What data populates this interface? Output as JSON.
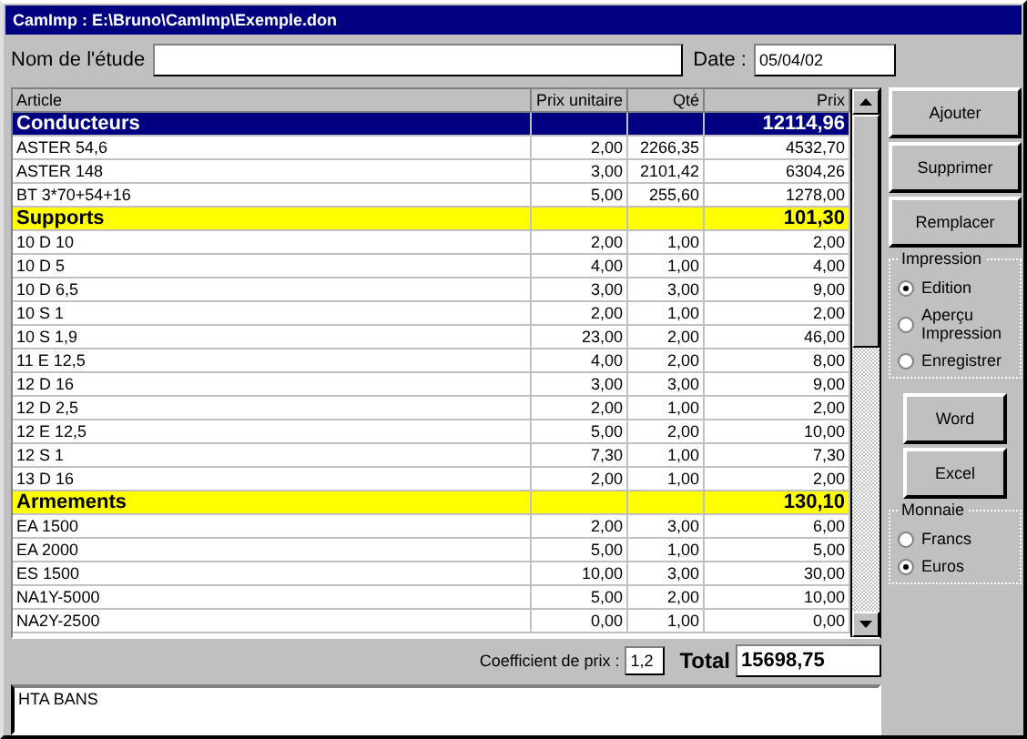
{
  "window": {
    "title": "CamImp : E:\\Bruno\\CamImp\\Exemple.don"
  },
  "study": {
    "label": "Nom de l'étude"
  },
  "date": {
    "label": "Date :",
    "value": "05/04/02"
  },
  "table": {
    "columns": [
      "Article",
      "Prix unitaire",
      "Qté",
      "Prix"
    ],
    "rows": [
      {
        "kind": "category",
        "name": "Conducteurs",
        "total": "12114,96",
        "color": "#000080"
      },
      {
        "kind": "item",
        "cells": [
          "ASTER  54,6",
          "2,00",
          "2266,35",
          "4532,70"
        ]
      },
      {
        "kind": "item",
        "cells": [
          "ASTER  148",
          "3,00",
          "2101,42",
          "6304,26"
        ]
      },
      {
        "kind": "item",
        "cells": [
          "BT  3*70+54+16",
          "5,00",
          "255,60",
          "1278,00"
        ]
      },
      {
        "kind": "category",
        "name": "Supports",
        "total": "101,30",
        "color": "#ffff00"
      },
      {
        "kind": "item",
        "cells": [
          "10 D 10",
          "2,00",
          "1,00",
          "2,00"
        ]
      },
      {
        "kind": "item",
        "cells": [
          "10 D 5",
          "4,00",
          "1,00",
          "4,00"
        ]
      },
      {
        "kind": "item",
        "cells": [
          "10 D 6,5",
          "3,00",
          "3,00",
          "9,00"
        ]
      },
      {
        "kind": "item",
        "cells": [
          "10 S 1",
          "2,00",
          "1,00",
          "2,00"
        ]
      },
      {
        "kind": "item",
        "cells": [
          "10 S 1,9",
          "23,00",
          "2,00",
          "46,00"
        ]
      },
      {
        "kind": "item",
        "cells": [
          "11 E 12,5",
          "4,00",
          "2,00",
          "8,00"
        ]
      },
      {
        "kind": "item",
        "cells": [
          "12 D 16",
          "3,00",
          "3,00",
          "9,00"
        ]
      },
      {
        "kind": "item",
        "cells": [
          "12 D 2,5",
          "2,00",
          "1,00",
          "2,00"
        ]
      },
      {
        "kind": "item",
        "cells": [
          "12 E 12,5",
          "5,00",
          "2,00",
          "10,00"
        ]
      },
      {
        "kind": "item",
        "cells": [
          "12 S 1",
          "7,30",
          "1,00",
          "7,30"
        ]
      },
      {
        "kind": "item",
        "cells": [
          "13 D 16",
          "2,00",
          "1,00",
          "2,00"
        ]
      },
      {
        "kind": "category",
        "name": "Armements",
        "total": "130,10",
        "color": "#ffff00"
      },
      {
        "kind": "item",
        "cells": [
          "EA 1500",
          "2,00",
          "3,00",
          "6,00"
        ]
      },
      {
        "kind": "item",
        "cells": [
          "EA 2000",
          "5,00",
          "1,00",
          "5,00"
        ]
      },
      {
        "kind": "item",
        "cells": [
          "ES 1500",
          "10,00",
          "3,00",
          "30,00"
        ]
      },
      {
        "kind": "item",
        "cells": [
          "NA1Y-5000",
          "5,00",
          "2,00",
          "10,00"
        ]
      },
      {
        "kind": "item",
        "cells": [
          "NA2Y-2500",
          "0,00",
          "1,00",
          "0,00"
        ]
      }
    ]
  },
  "actions": [
    "Ajouter",
    "Supprimer",
    "Remplacer"
  ],
  "impression": {
    "title": "Impression",
    "options": [
      {
        "label": "Edition",
        "selected": true
      },
      {
        "label": "Aperçu Impression",
        "selected": false
      },
      {
        "label": "Enregistrer",
        "selected": false
      }
    ]
  },
  "exports": [
    "Word",
    "Excel"
  ],
  "currency": {
    "title": "Monnaie",
    "options": [
      {
        "label": "Francs",
        "selected": false
      },
      {
        "label": "Euros",
        "selected": true
      }
    ]
  },
  "coefficient": {
    "label": "Coefficient de prix :",
    "value": "1,2"
  },
  "total": {
    "label": "Total",
    "value": "15698,75"
  },
  "notes": "HTA BANS"
}
